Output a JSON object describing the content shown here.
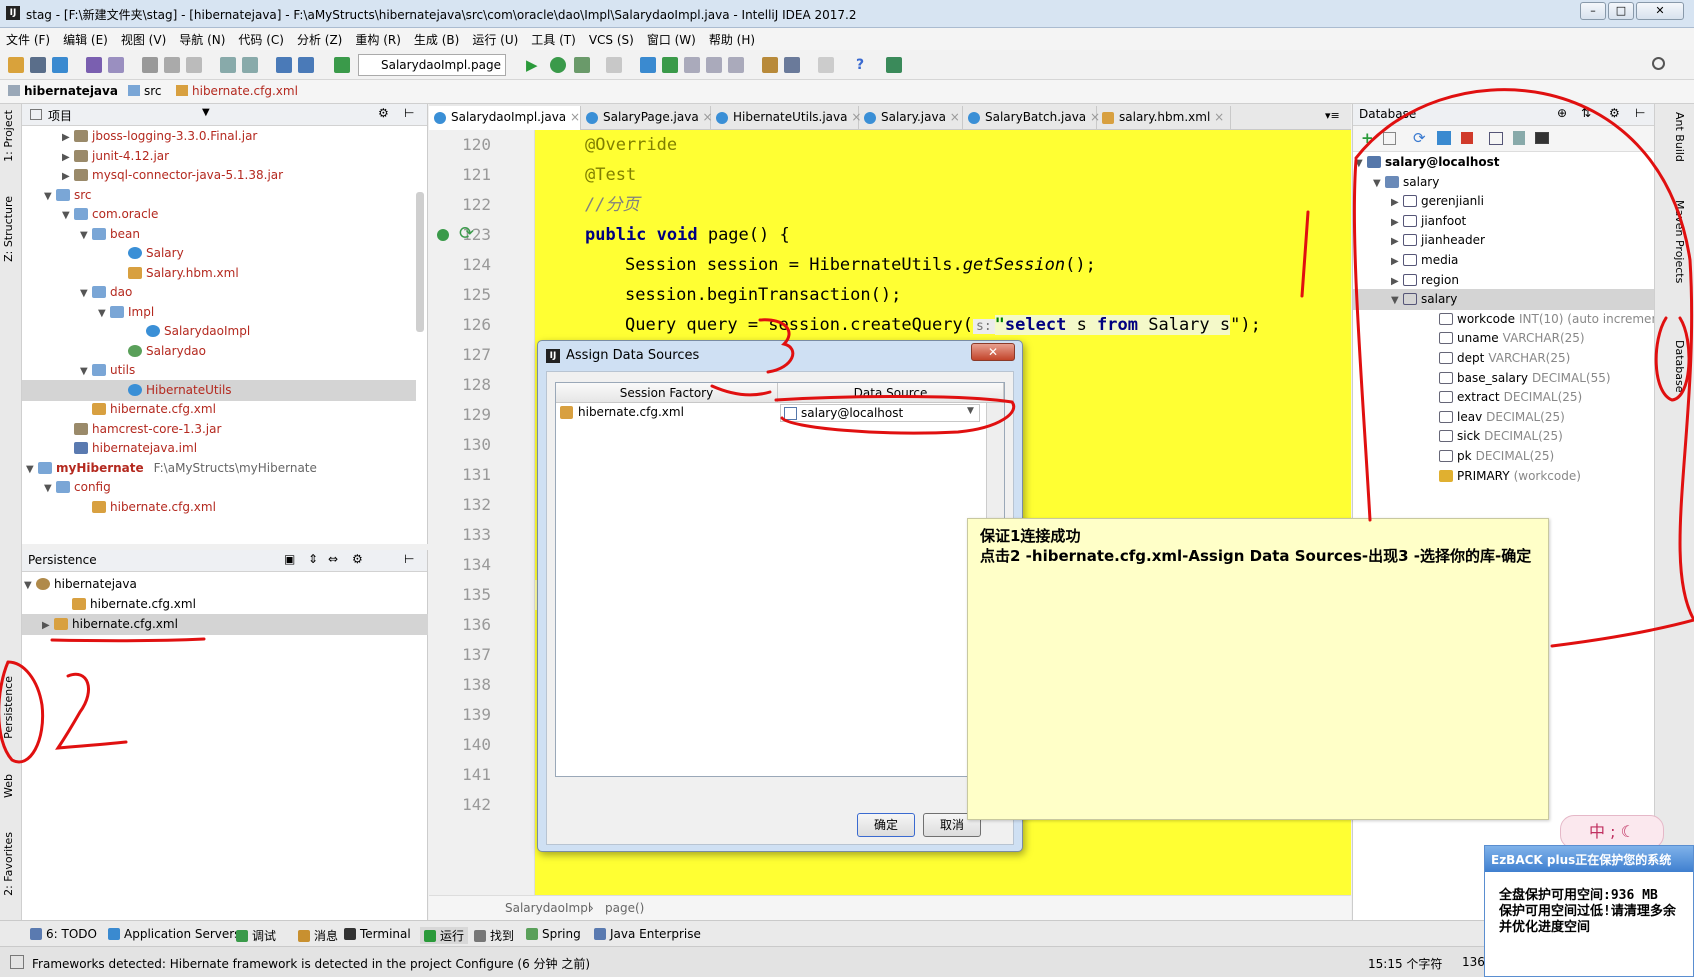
{
  "window": {
    "title": "stag - [F:\\新建文件夹\\stag] - [hibernatejava] - F:\\aMyStructs\\hibernatejava\\src\\com\\oracle\\dao\\Impl\\SalarydaoImpl.java - IntelliJ IDEA 2017.2"
  },
  "menu": [
    "文件 (F)",
    "编辑 (E)",
    "视图 (V)",
    "导航 (N)",
    "代码 (C)",
    "分析 (Z)",
    "重构 (R)",
    "生成 (B)",
    "运行 (U)",
    "工具 (T)",
    "VCS (S)",
    "窗口 (W)",
    "帮助 (H)"
  ],
  "toolbar": {
    "run_config": "SalarydaoImpl.page"
  },
  "breadcrumb": [
    "hibernatejava",
    "src",
    "hibernate.cfg.xml"
  ],
  "left_strip": [
    "1: Project",
    "Z: Structure",
    "Persistence",
    "Web",
    "2: Favorites"
  ],
  "project": {
    "header": "项目",
    "rows": [
      {
        "text": "jboss-logging-3.3.0.Final.jar",
        "indent": 2,
        "arrow": "▶",
        "color": "red"
      },
      {
        "text": "junit-4.12.jar",
        "indent": 2,
        "arrow": "▶",
        "color": "red"
      },
      {
        "text": "mysql-connector-java-5.1.38.jar",
        "indent": 2,
        "arrow": "▶",
        "color": "red"
      },
      {
        "text": "src",
        "indent": 1,
        "arrow": "▼",
        "color": "red"
      },
      {
        "text": "com.oracle",
        "indent": 2,
        "arrow": "▼",
        "color": "red"
      },
      {
        "text": "bean",
        "indent": 3,
        "arrow": "▼",
        "color": "red"
      },
      {
        "text": "Salary",
        "indent": 5,
        "arrow": "",
        "color": "red"
      },
      {
        "text": "Salary.hbm.xml",
        "indent": 5,
        "arrow": "",
        "color": "red"
      },
      {
        "text": "dao",
        "indent": 3,
        "arrow": "▼",
        "color": "red"
      },
      {
        "text": "Impl",
        "indent": 4,
        "arrow": "▼",
        "color": "red"
      },
      {
        "text": "SalarydaoImpl",
        "indent": 6,
        "arrow": "",
        "color": "red"
      },
      {
        "text": "Salarydao",
        "indent": 5,
        "arrow": "",
        "color": "red"
      },
      {
        "text": "utils",
        "indent": 3,
        "arrow": "▼",
        "color": "red"
      },
      {
        "text": "HibernateUtils",
        "indent": 5,
        "arrow": "",
        "color": "red",
        "selected": true
      },
      {
        "text": "hibernate.cfg.xml",
        "indent": 3,
        "arrow": "",
        "color": "red"
      },
      {
        "text": "hamcrest-core-1.3.jar",
        "indent": 2,
        "arrow": "",
        "color": "red"
      },
      {
        "text": "hibernatejava.iml",
        "indent": 2,
        "arrow": "",
        "color": "red"
      },
      {
        "text": "myHibernate",
        "suffix": "F:\\aMyStructs\\myHibernate",
        "indent": 0,
        "arrow": "▼",
        "color": "red",
        "bold": true
      },
      {
        "text": "config",
        "indent": 1,
        "arrow": "▼",
        "color": "red"
      },
      {
        "text": "hibernate.cfg.xml",
        "indent": 3,
        "arrow": "",
        "color": "red"
      }
    ]
  },
  "persistence": {
    "header": "Persistence",
    "rows": [
      {
        "text": "hibernatejava",
        "indent": 0,
        "arrow": "▼"
      },
      {
        "text": "hibernate.cfg.xml",
        "indent": 2,
        "arrow": ""
      },
      {
        "text": "hibernate.cfg.xml",
        "indent": 1,
        "arrow": "▶",
        "selected": true
      }
    ]
  },
  "editor": {
    "tabs": [
      "SalarydaoImpl.java",
      "SalaryPage.java",
      "HibernateUtils.java",
      "Salary.java",
      "SalaryBatch.java",
      "salary.hbm.xml"
    ],
    "line_numbers": [
      "120",
      "121",
      "122",
      "123",
      "124",
      "125",
      "126",
      "127",
      "128",
      "129",
      "130",
      "131",
      "132",
      "133",
      "134",
      "135",
      "136",
      "137",
      "138",
      "139",
      "140",
      "141",
      "142"
    ],
    "code": {
      "l120": "@Override",
      "l121": "@Test",
      "l122": "//分页",
      "l123_kw": "public void",
      "l123_rest": " page() {",
      "l124_a": "Session session = HibernateUtils.",
      "l124_b": "getSession",
      "l124_c": "();",
      "l125": "session.beginTransaction();",
      "l126_a": "Query query = session.createQuery(",
      "l126_hint": "s:",
      "l126_q1": "\"",
      "l126_k1": "select",
      "l126_m": " s ",
      "l126_k2": "from",
      "l126_e": " Salary s",
      "l126_q2": "\");"
    },
    "breadcrumb": [
      "SalarydaoImpl",
      "page()"
    ]
  },
  "database": {
    "header": "Database",
    "rows": [
      {
        "text": "salary@localhost",
        "indent": 0,
        "arrow": "▼",
        "bold": true
      },
      {
        "text": "salary",
        "indent": 1,
        "arrow": "▼"
      },
      {
        "text": "gerenjianli",
        "indent": 2,
        "arrow": "▶"
      },
      {
        "text": "jianfoot",
        "indent": 2,
        "arrow": "▶"
      },
      {
        "text": "jianheader",
        "indent": 2,
        "arrow": "▶"
      },
      {
        "text": "media",
        "indent": 2,
        "arrow": "▶"
      },
      {
        "text": "region",
        "indent": 2,
        "arrow": "▶"
      },
      {
        "text": "salary",
        "indent": 2,
        "arrow": "▼",
        "selected": true
      },
      {
        "text": "workcode",
        "type": "INT(10) (auto increment)",
        "indent": 4,
        "arrow": ""
      },
      {
        "text": "uname",
        "type": "VARCHAR(25)",
        "indent": 4,
        "arrow": ""
      },
      {
        "text": "dept",
        "type": "VARCHAR(25)",
        "indent": 4,
        "arrow": ""
      },
      {
        "text": "base_salary",
        "type": "DECIMAL(55)",
        "indent": 4,
        "arrow": ""
      },
      {
        "text": "extract",
        "type": "DECIMAL(25)",
        "indent": 4,
        "arrow": ""
      },
      {
        "text": "leav",
        "type": "DECIMAL(25)",
        "indent": 4,
        "arrow": ""
      },
      {
        "text": "sick",
        "type": "DECIMAL(25)",
        "indent": 4,
        "arrow": ""
      },
      {
        "text": "pk",
        "type": "DECIMAL(25)",
        "indent": 4,
        "arrow": ""
      },
      {
        "text": "PRIMARY",
        "type": "(workcode)",
        "indent": 4,
        "arrow": "",
        "key": true
      }
    ]
  },
  "right_strip": [
    "Ant Build",
    "Maven Projects",
    "Database"
  ],
  "dialog": {
    "title": "Assign Data Sources",
    "col_factory": "Session Factory",
    "col_source": "Data Source",
    "factory_value": "hibernate.cfg.xml",
    "source_value": "salary@localhost",
    "ok": "确定",
    "cancel": "取消"
  },
  "note": {
    "line1": "保证1连接成功",
    "line2": "点击2 -hibernate.cfg.xml-Assign Data Sources-出现3 -选择你的库-确定"
  },
  "bottom_tabs": [
    "6: TODO",
    "Application Servers",
    "调试",
    "消息",
    "Terminal",
    "运行",
    "找到",
    "Spring",
    "Java Enterprise"
  ],
  "status": {
    "message": "Frameworks detected: Hibernate framework is detected in the project Configure (6 分钟 之前)",
    "position": "15:15 个字符",
    "extra": "136"
  },
  "ime": {
    "text": "中 ;"
  },
  "ezback": {
    "header": "EzBACK plus正在保护您的系统",
    "line1": "全盘保护可用空间:936 MB",
    "line2": "保护可用空间过低!请清理多余",
    "line3": "并优化进度空间"
  },
  "colors": {
    "code_bg": "#ffff33",
    "annotation_red": "#e01010",
    "keyword": "#000080"
  }
}
